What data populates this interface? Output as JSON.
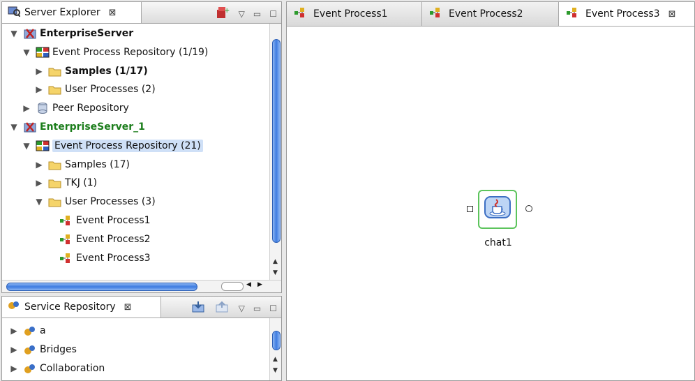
{
  "server_explorer": {
    "title": "Server Explorer",
    "tree": [
      {
        "label": "EnterpriseServer",
        "style": "bold",
        "icon": "server-icon",
        "twisty": "open",
        "indent": 0
      },
      {
        "label": "Event Process Repository (1/19)",
        "style": "",
        "icon": "repository-icon",
        "twisty": "open",
        "indent": 1
      },
      {
        "label": "Samples (1/17)",
        "style": "bold",
        "icon": "folder-icon",
        "twisty": "closed",
        "indent": 2
      },
      {
        "label": "User Processes (2)",
        "style": "",
        "icon": "folder-icon",
        "twisty": "closed",
        "indent": 2
      },
      {
        "label": "Peer Repository",
        "style": "",
        "icon": "database-icon",
        "twisty": "closed",
        "indent": 1
      },
      {
        "label": "EnterpriseServer_1",
        "style": "bold green",
        "icon": "server-icon",
        "twisty": "open",
        "indent": 0
      },
      {
        "label": "Event Process Repository (21)",
        "style": "selected",
        "icon": "repository-icon",
        "twisty": "open",
        "indent": 1
      },
      {
        "label": "Samples (17)",
        "style": "",
        "icon": "folder-icon",
        "twisty": "closed",
        "indent": 2
      },
      {
        "label": "TKJ (1)",
        "style": "",
        "icon": "folder-icon",
        "twisty": "closed",
        "indent": 2
      },
      {
        "label": "User Processes (3)",
        "style": "",
        "icon": "folder-icon",
        "twisty": "open",
        "indent": 2
      },
      {
        "label": "Event Process1",
        "style": "",
        "icon": "event-process-icon",
        "twisty": "none",
        "indent": 3
      },
      {
        "label": "Event Process2",
        "style": "",
        "icon": "event-process-icon",
        "twisty": "none",
        "indent": 3
      },
      {
        "label": "Event Process3",
        "style": "",
        "icon": "event-process-icon",
        "twisty": "none",
        "indent": 3
      }
    ]
  },
  "service_repository": {
    "title": "Service Repository",
    "tree": [
      {
        "label": "a",
        "icon": "service-icon"
      },
      {
        "label": "Bridges",
        "icon": "service-icon"
      },
      {
        "label": "Collaboration",
        "icon": "service-icon"
      }
    ]
  },
  "editor": {
    "tabs": [
      {
        "label": "Event Process1",
        "active": false
      },
      {
        "label": "Event Process2",
        "active": false
      },
      {
        "label": "Event Process3",
        "active": true
      }
    ],
    "node": {
      "label": "chat1",
      "icon": "java-icon"
    }
  },
  "colors": {
    "selection": "#cfe0f7",
    "scroll_accent": "#3d7be0",
    "node_border": "#5cc45c"
  }
}
